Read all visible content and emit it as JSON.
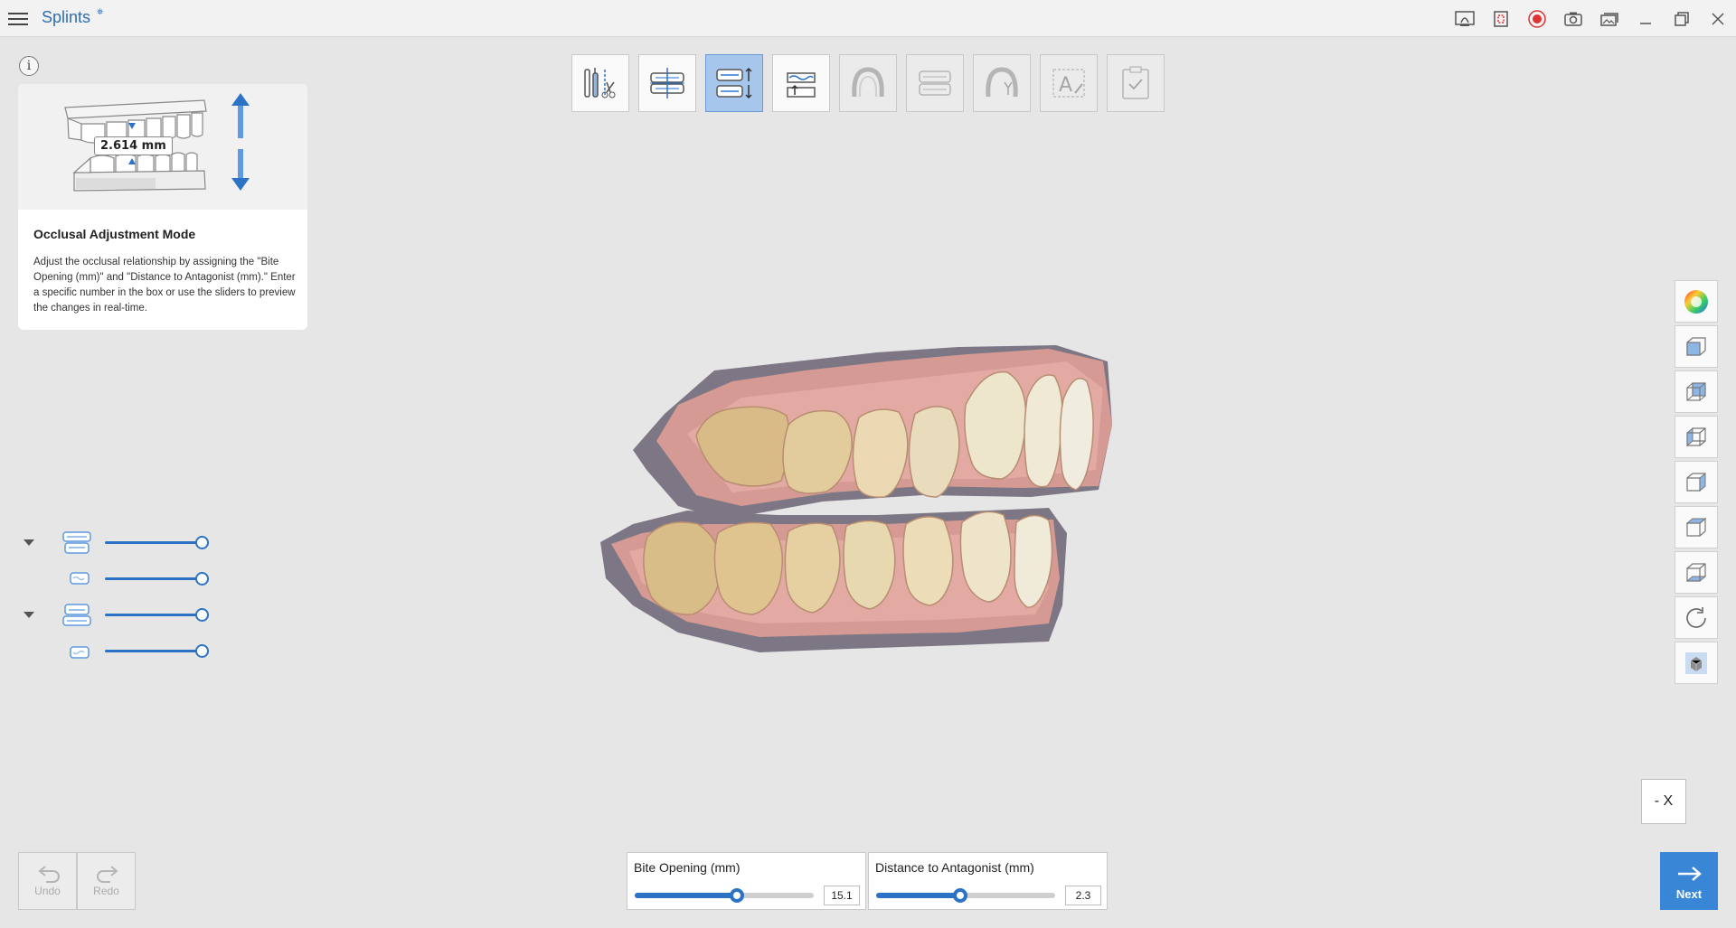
{
  "app": {
    "title": "Splints",
    "title_badge": "⛯"
  },
  "titlebar_icons": [
    "scan-data-icon",
    "crop-icon",
    "record-icon",
    "camera-icon",
    "gallery-icon"
  ],
  "info": {
    "measure_label": "2.614 mm",
    "heading": "Occlusal Adjustment Mode",
    "text": "Adjust the occlusal relationship by assigning the \"Bite Opening (mm)\" and \"Distance to Antagonist (mm).\"  Enter a specific number in the box or use the sliders to preview the changes in real-time."
  },
  "steps": [
    {
      "name": "trim-tools-step",
      "state": "normal"
    },
    {
      "name": "alignment-step",
      "state": "normal"
    },
    {
      "name": "occlusal-adjustment-step",
      "state": "active"
    },
    {
      "name": "insertion-direction-step",
      "state": "normal"
    },
    {
      "name": "outline-step",
      "state": "disabled"
    },
    {
      "name": "splint-design-step",
      "state": "disabled"
    },
    {
      "name": "finalize-step",
      "state": "disabled"
    },
    {
      "name": "text-label-step",
      "state": "disabled"
    },
    {
      "name": "complete-step",
      "state": "disabled"
    }
  ],
  "visibility": [
    {
      "name": "maxilla-group",
      "has_caret": true,
      "opacity": 1.0
    },
    {
      "name": "maxilla-scan",
      "has_caret": false,
      "opacity": 1.0
    },
    {
      "name": "mandible-group",
      "has_caret": true,
      "opacity": 1.0
    },
    {
      "name": "mandible-scan",
      "has_caret": false,
      "opacity": 1.0
    }
  ],
  "right_tools": [
    "color-wheel-icon",
    "view-front-icon",
    "view-back-icon",
    "view-left-icon",
    "view-right-icon",
    "view-top-icon",
    "view-bottom-icon",
    "rotate-icon",
    "solid-view-icon"
  ],
  "axis_button": "- X",
  "undo": {
    "label": "Undo"
  },
  "redo": {
    "label": "Redo"
  },
  "bite_opening": {
    "title": "Bite Opening (mm)",
    "value": "15.1",
    "level": 0.57
  },
  "antagonist": {
    "title": "Distance to Antagonist (mm)",
    "value": "2.3",
    "level": 0.47
  },
  "next": {
    "label": "Next"
  },
  "colors": {
    "accent": "#2c73c6",
    "active_step": "#a6c6ec",
    "next_bg": "#3a86d6"
  }
}
